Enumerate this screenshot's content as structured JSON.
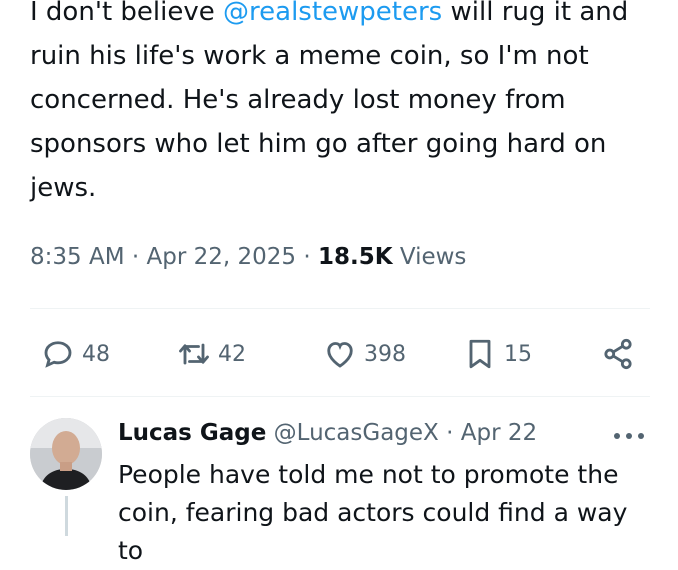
{
  "tweet": {
    "text_before": "I don't believe ",
    "mention": "@realstewpeters",
    "text_after": "  will rug it and ruin his life's work a meme coin, so I'm not concerned. He's already lost money from sponsors who let him go after going hard on jews.",
    "time": "8:35 AM",
    "dot1": " · ",
    "date": "Apr 22, 2025",
    "dot2": " · ",
    "views_count": "18.5K",
    "views_label": " Views"
  },
  "actions": {
    "replies": "48",
    "reposts": "42",
    "likes": "398",
    "bookmarks": "15"
  },
  "reply": {
    "name": "Lucas Gage",
    "handle": "@LucasGageX",
    "sep": " · ",
    "date": "Apr 22",
    "text": "People have told me not to promote the coin, fearing bad actors could find a way to"
  },
  "colors": {
    "accent": "#1d9bf0",
    "secondary_text": "#536471",
    "divider": "#eff3f4"
  },
  "icons": [
    "reply-icon",
    "repost-icon",
    "like-icon",
    "bookmark-icon",
    "share-icon",
    "more-icon",
    "avatar"
  ]
}
